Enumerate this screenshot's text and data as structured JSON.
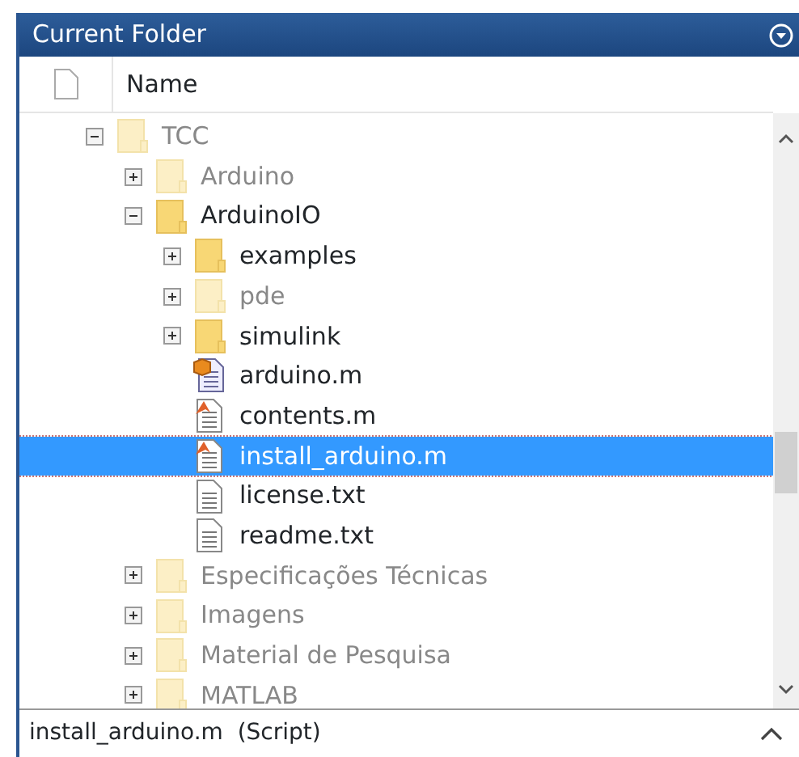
{
  "panel": {
    "title": "Current Folder"
  },
  "columns": [
    {
      "label": "Name"
    }
  ],
  "tree": [
    {
      "name": "TCC",
      "kind": "folder",
      "dimmed": true,
      "expanded": true,
      "selected": false,
      "children": [
        {
          "name": "Arduino",
          "kind": "folder",
          "dimmed": true,
          "expanded": false,
          "selected": false
        },
        {
          "name": "ArduinoIO",
          "kind": "folder",
          "dimmed": false,
          "expanded": true,
          "selected": false,
          "children": [
            {
              "name": "examples",
              "kind": "folder",
              "dimmed": false,
              "expanded": false,
              "selected": false
            },
            {
              "name": "pde",
              "kind": "folder",
              "dimmed": true,
              "expanded": false,
              "selected": false
            },
            {
              "name": "simulink",
              "kind": "folder",
              "dimmed": false,
              "expanded": false,
              "selected": false
            },
            {
              "name": "arduino.m",
              "kind": "class",
              "dimmed": false,
              "selected": false
            },
            {
              "name": "contents.m",
              "kind": "script",
              "dimmed": false,
              "selected": false
            },
            {
              "name": "install_arduino.m",
              "kind": "script",
              "dimmed": false,
              "selected": true
            },
            {
              "name": "license.txt",
              "kind": "text",
              "dimmed": false,
              "selected": false
            },
            {
              "name": "readme.txt",
              "kind": "text",
              "dimmed": false,
              "selected": false
            }
          ]
        },
        {
          "name": "Especificações Técnicas",
          "kind": "folder",
          "dimmed": true,
          "expanded": false,
          "selected": false
        },
        {
          "name": "Imagens",
          "kind": "folder",
          "dimmed": true,
          "expanded": false,
          "selected": false
        },
        {
          "name": "Material de Pesquisa",
          "kind": "folder",
          "dimmed": true,
          "expanded": false,
          "selected": false
        },
        {
          "name": "MATLAB",
          "kind": "folder",
          "dimmed": true,
          "expanded": false,
          "selected": false
        }
      ]
    }
  ],
  "status_bar": {
    "text": "install_arduino.m  (Script)"
  }
}
